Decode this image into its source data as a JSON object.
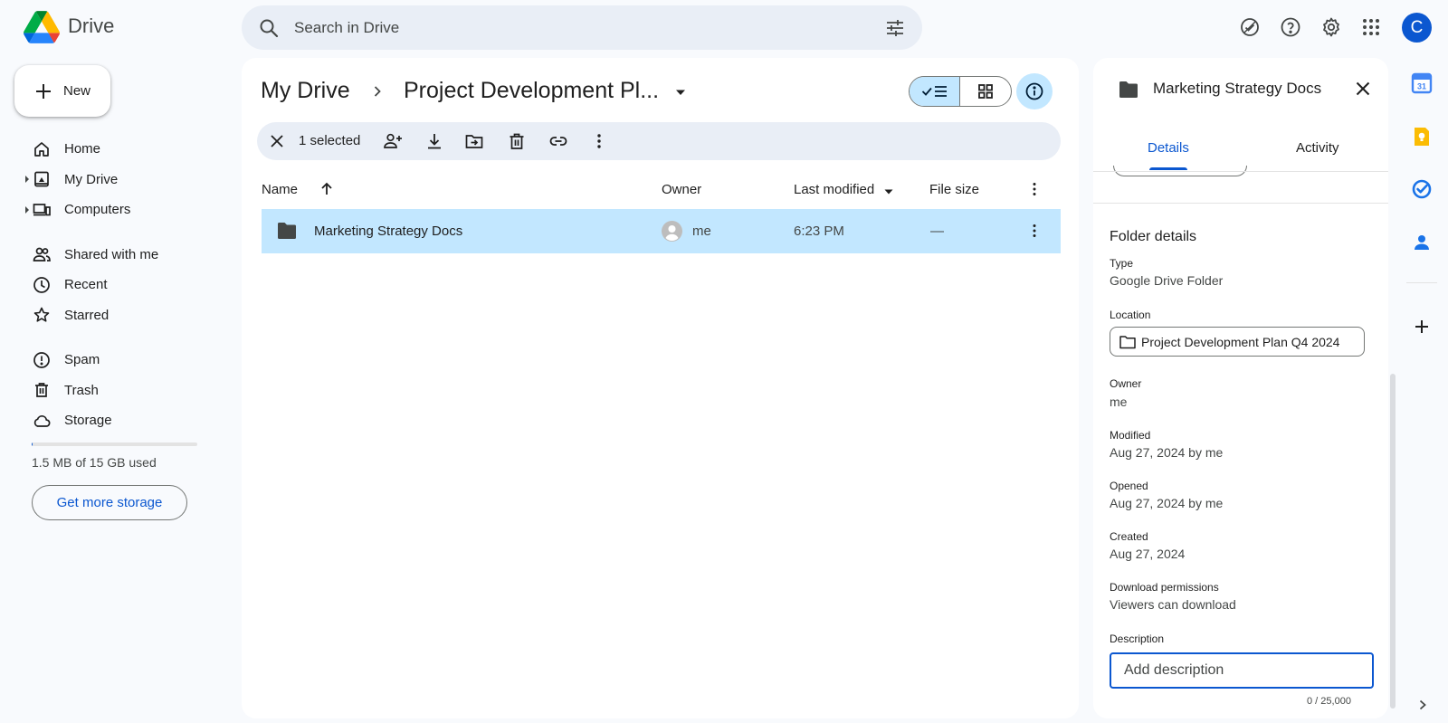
{
  "app": {
    "name": "Drive"
  },
  "header": {
    "search_placeholder": "Search in Drive",
    "user_initial": "C"
  },
  "sidebar": {
    "new_label": "New",
    "items": [
      {
        "label": "Home",
        "icon": "home-icon"
      },
      {
        "label": "My Drive",
        "icon": "my-drive-icon"
      },
      {
        "label": "Computers",
        "icon": "computers-icon"
      },
      {
        "label": "Shared with me",
        "icon": "shared-icon"
      },
      {
        "label": "Recent",
        "icon": "clock-icon"
      },
      {
        "label": "Starred",
        "icon": "star-icon"
      },
      {
        "label": "Spam",
        "icon": "spam-icon"
      },
      {
        "label": "Trash",
        "icon": "trash-icon"
      },
      {
        "label": "Storage",
        "icon": "cloud-icon"
      }
    ],
    "storage": {
      "used_text": "1.5 MB of 15 GB used",
      "used_fraction": 0.0001,
      "button_label": "Get more storage"
    }
  },
  "main": {
    "breadcrumb": {
      "root": "My Drive",
      "current": "Project Development Pl..."
    },
    "selection": {
      "count_label": "1 selected"
    },
    "columns": {
      "name": "Name",
      "owner": "Owner",
      "modified": "Last modified",
      "size": "File size"
    },
    "rows": [
      {
        "name": "Marketing Strategy Docs",
        "owner": "me",
        "modified": "6:23 PM",
        "size": "—"
      }
    ]
  },
  "details": {
    "title": "Marketing Strategy Docs",
    "tabs": [
      "Details",
      "Activity"
    ],
    "section_title": "Folder details",
    "type_label": "Type",
    "type_value": "Google Drive Folder",
    "location_label": "Location",
    "location_value": "Project Development Plan Q4 2024",
    "owner_label": "Owner",
    "owner_value": "me",
    "modified_label": "Modified",
    "modified_value": "Aug 27, 2024 by me",
    "opened_label": "Opened",
    "opened_value": "Aug 27, 2024 by me",
    "created_label": "Created",
    "created_value": "Aug 27, 2024",
    "download_label": "Download permissions",
    "download_value": "Viewers can download",
    "description_label": "Description",
    "description_placeholder": "Add description",
    "description_counter": "0 / 25,000"
  },
  "colors": {
    "accent": "#0b57d0",
    "selected_row": "#c2e7ff",
    "surface": "#f8fafd",
    "search_bg": "#e9eef6"
  }
}
